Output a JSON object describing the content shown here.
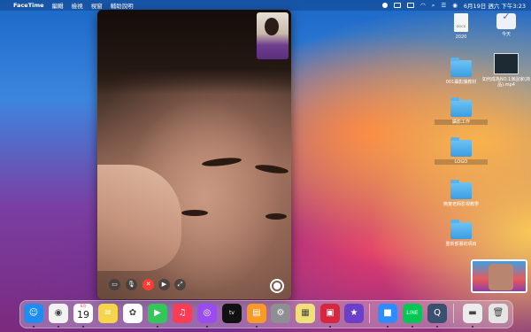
{
  "menubar": {
    "apple": "",
    "app_name": "FaceTime",
    "items": [
      "編輯",
      "檢視",
      "視窗",
      "輔助說明"
    ],
    "clock": "6月19日 週六 下午3:23"
  },
  "desktop": {
    "items": [
      {
        "label": "2020",
        "kind": "document",
        "badge": "DOCX"
      },
      {
        "label": "今天",
        "kind": "calendar"
      },
      {
        "label": "001攝影課教材",
        "kind": "folder"
      },
      {
        "label": "如何成為NO.1演說家(商品).mp4",
        "kind": "video"
      },
      {
        "label": "攝影工作",
        "kind": "folder"
      },
      {
        "label": "LOGO",
        "kind": "folder"
      },
      {
        "label": "簡實老師影視教學",
        "kind": "folder"
      },
      {
        "label": "重新部署的項目",
        "kind": "folder"
      }
    ]
  },
  "dock": {
    "apps": [
      {
        "name": "Finder",
        "icon": "finder-icon",
        "color": "#1e8cf0"
      },
      {
        "name": "Chrome",
        "icon": "chrome-icon",
        "color": "#f2f2f2"
      },
      {
        "name": "Calendar",
        "icon": "calendar-icon",
        "color": "#ffffff",
        "text": "19",
        "sub": "6月"
      },
      {
        "name": "Notes",
        "icon": "notes-icon",
        "color": "#f7d54a"
      },
      {
        "name": "Photos",
        "icon": "photos-icon",
        "color": "#ffffff"
      },
      {
        "name": "FaceTime",
        "icon": "facetime-icon",
        "color": "#33c759"
      },
      {
        "name": "Music",
        "icon": "music-icon",
        "color": "#fa3c54"
      },
      {
        "name": "Podcasts",
        "icon": "podcasts-icon",
        "color": "#9a4cf0"
      },
      {
        "name": "TV",
        "icon": "tv-icon",
        "color": "#111111"
      },
      {
        "name": "Books",
        "icon": "books-icon",
        "color": "#f79a26"
      },
      {
        "name": "System Preferences",
        "icon": "gear-icon",
        "color": "#8e8e93"
      },
      {
        "name": "Stickies",
        "icon": "stickies-icon",
        "color": "#f1e07a"
      },
      {
        "name": "Photo Booth",
        "icon": "photobooth-icon",
        "color": "#d7263d"
      },
      {
        "name": "iMovie",
        "icon": "imovie-icon",
        "color": "#6b3fc9"
      },
      {
        "name": "Zoom",
        "icon": "zoom-icon",
        "color": "#2d8cff"
      },
      {
        "name": "LINE",
        "icon": "line-icon",
        "color": "#06c755"
      },
      {
        "name": "QuickTime",
        "icon": "quicktime-icon",
        "color": "#3b4f6e"
      },
      {
        "name": "Screenshot",
        "icon": "screenshot-icon",
        "color": "#ececec"
      },
      {
        "name": "Trash",
        "icon": "trash-icon",
        "color": "#e5e5e5"
      }
    ]
  }
}
